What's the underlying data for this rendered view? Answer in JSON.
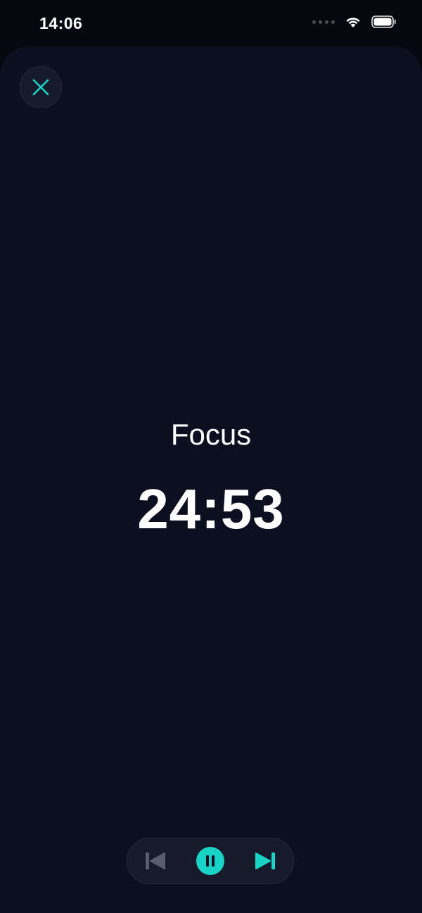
{
  "status_bar": {
    "time": "14:06"
  },
  "session": {
    "label": "Focus",
    "remaining_time": "24:53"
  },
  "colors": {
    "accent": "#19d3c5",
    "background": "#0c0f20",
    "disabled": "#5a5e6c"
  },
  "icons": {
    "close": "close-icon",
    "previous": "skip-previous-icon",
    "pause": "pause-icon",
    "next": "skip-next-icon",
    "wifi": "wifi-icon",
    "battery": "battery-icon"
  }
}
